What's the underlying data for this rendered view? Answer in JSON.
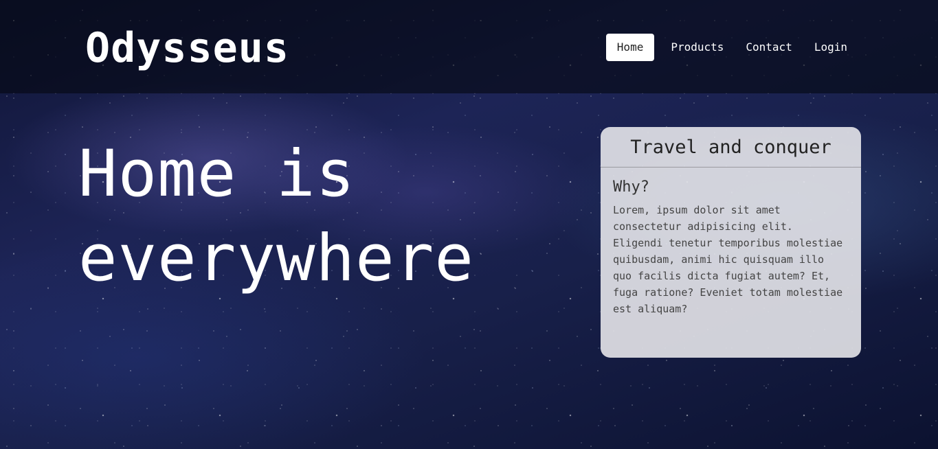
{
  "header": {
    "brand": "Odysseus",
    "nav": [
      {
        "label": "Home",
        "active": true
      },
      {
        "label": "Products",
        "active": false
      },
      {
        "label": "Contact",
        "active": false
      },
      {
        "label": "Login",
        "active": false
      }
    ]
  },
  "hero": {
    "title": "Home is everywhere"
  },
  "card": {
    "header": "Travel and conquer",
    "subtitle": "Why?",
    "text": "Lorem, ipsum dolor sit amet consectetur adipisicing elit. Eligendi tenetur temporibus molestiae quibusdam, animi hic quisquam illo quo facilis dicta fugiat autem? Et, fuga ratione? Eveniet totam molestiae est aliquam?"
  },
  "colors": {
    "header_bg": "#05081299",
    "active_nav_bg": "#ffffff",
    "card_bg": "#e6e6ea",
    "text_light": "#ffffff"
  }
}
